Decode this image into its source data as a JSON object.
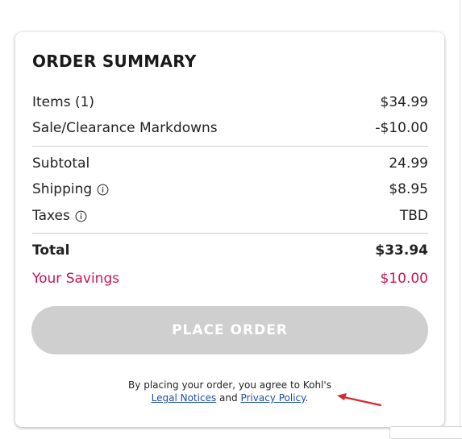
{
  "summary": {
    "title": "ORDER SUMMARY",
    "items_label": "Items (1)",
    "items_value": "$34.99",
    "markdowns_label": "Sale/Clearance Markdowns",
    "markdowns_value": "-$10.00",
    "subtotal_label": "Subtotal",
    "subtotal_value": "24.99",
    "shipping_label": "Shipping",
    "shipping_value": "$8.95",
    "taxes_label": "Taxes",
    "taxes_value": "TBD",
    "total_label": "Total",
    "total_value": "$33.94",
    "savings_label": "Your Savings",
    "savings_value": "$10.00"
  },
  "actions": {
    "place_order_label": "PLACE ORDER"
  },
  "legal": {
    "prefix": "By placing your order, you agree to Kohl's",
    "legal_link": "Legal Notices",
    "and_text": "and",
    "privacy_link": "Privacy Policy",
    "suffix": "."
  },
  "colors": {
    "savings": "#c8155a",
    "button_disabled": "#cfcfcf",
    "link": "#1f4fa5",
    "arrow": "#d42a2a"
  },
  "icons": [
    "info-icon",
    "red-arrow-annotation"
  ]
}
